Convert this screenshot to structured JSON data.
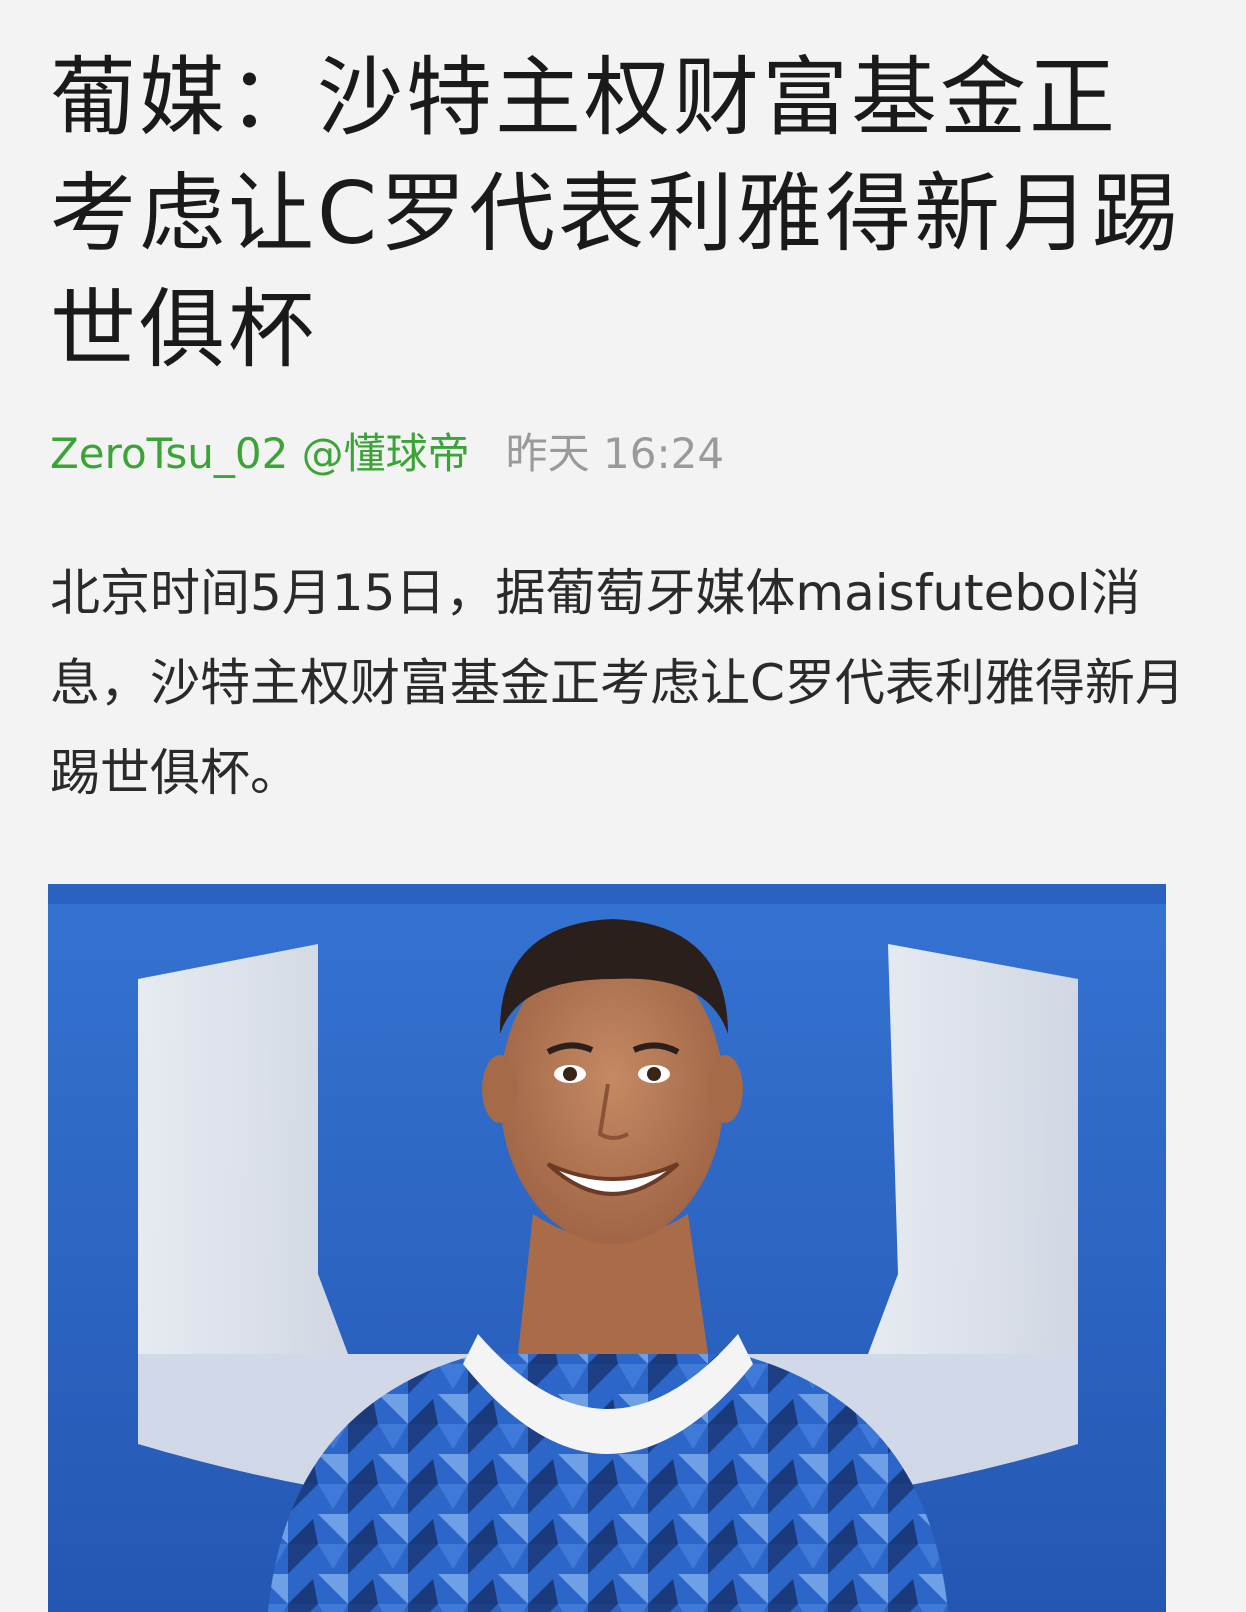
{
  "article": {
    "title": "葡媒：沙特主权财富基金正考虑让C罗代表利雅得新月踢世俱杯",
    "author": "ZeroTsu_02 @懂球帝",
    "timestamp": "昨天 16:24",
    "body": "北京时间5月15日，据葡萄牙媒体maisfutebol消息，沙特主权财富基金正考虑让C罗代表利雅得新月踢世俱杯。"
  },
  "photo": {
    "subject": "player-in-blue-jersey",
    "colors": {
      "background": "#2f6cc9",
      "logo": "#e6e8ec",
      "jersey": "#2b63c6",
      "skin": "#b57a55",
      "hair": "#2a1f1a",
      "collar": "#f4f4f4"
    }
  }
}
